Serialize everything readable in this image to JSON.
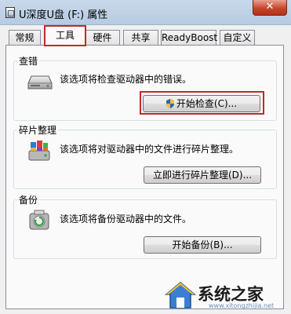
{
  "window": {
    "title": "U深度U盘 (F:) 属性",
    "close_label": "✕"
  },
  "tabs": [
    {
      "label": "常规",
      "active": false
    },
    {
      "label": "工具",
      "active": true
    },
    {
      "label": "硬件",
      "active": false
    },
    {
      "label": "共享",
      "active": false
    },
    {
      "label": "ReadyBoost",
      "active": false
    },
    {
      "label": "自定义",
      "active": false
    }
  ],
  "groups": {
    "check": {
      "title": "查错",
      "description": "该选项将检查驱动器中的错误。",
      "button_label": "开始检查(C)...",
      "icon": "drive-check-icon",
      "button_has_shield": true
    },
    "defrag": {
      "title": "碎片整理",
      "description": "该选项将对驱动器中的文件进行碎片整理。",
      "button_label": "立即进行碎片整理(D)...",
      "icon": "defrag-icon"
    },
    "backup": {
      "title": "备份",
      "description": "该选项将备份驱动器中的文件。",
      "button_label": "开始备份(B)...",
      "icon": "backup-icon"
    }
  },
  "highlight_color": "#c3282b",
  "watermark": {
    "text": "系统之家",
    "url": "www.xitongzhijia.net"
  }
}
